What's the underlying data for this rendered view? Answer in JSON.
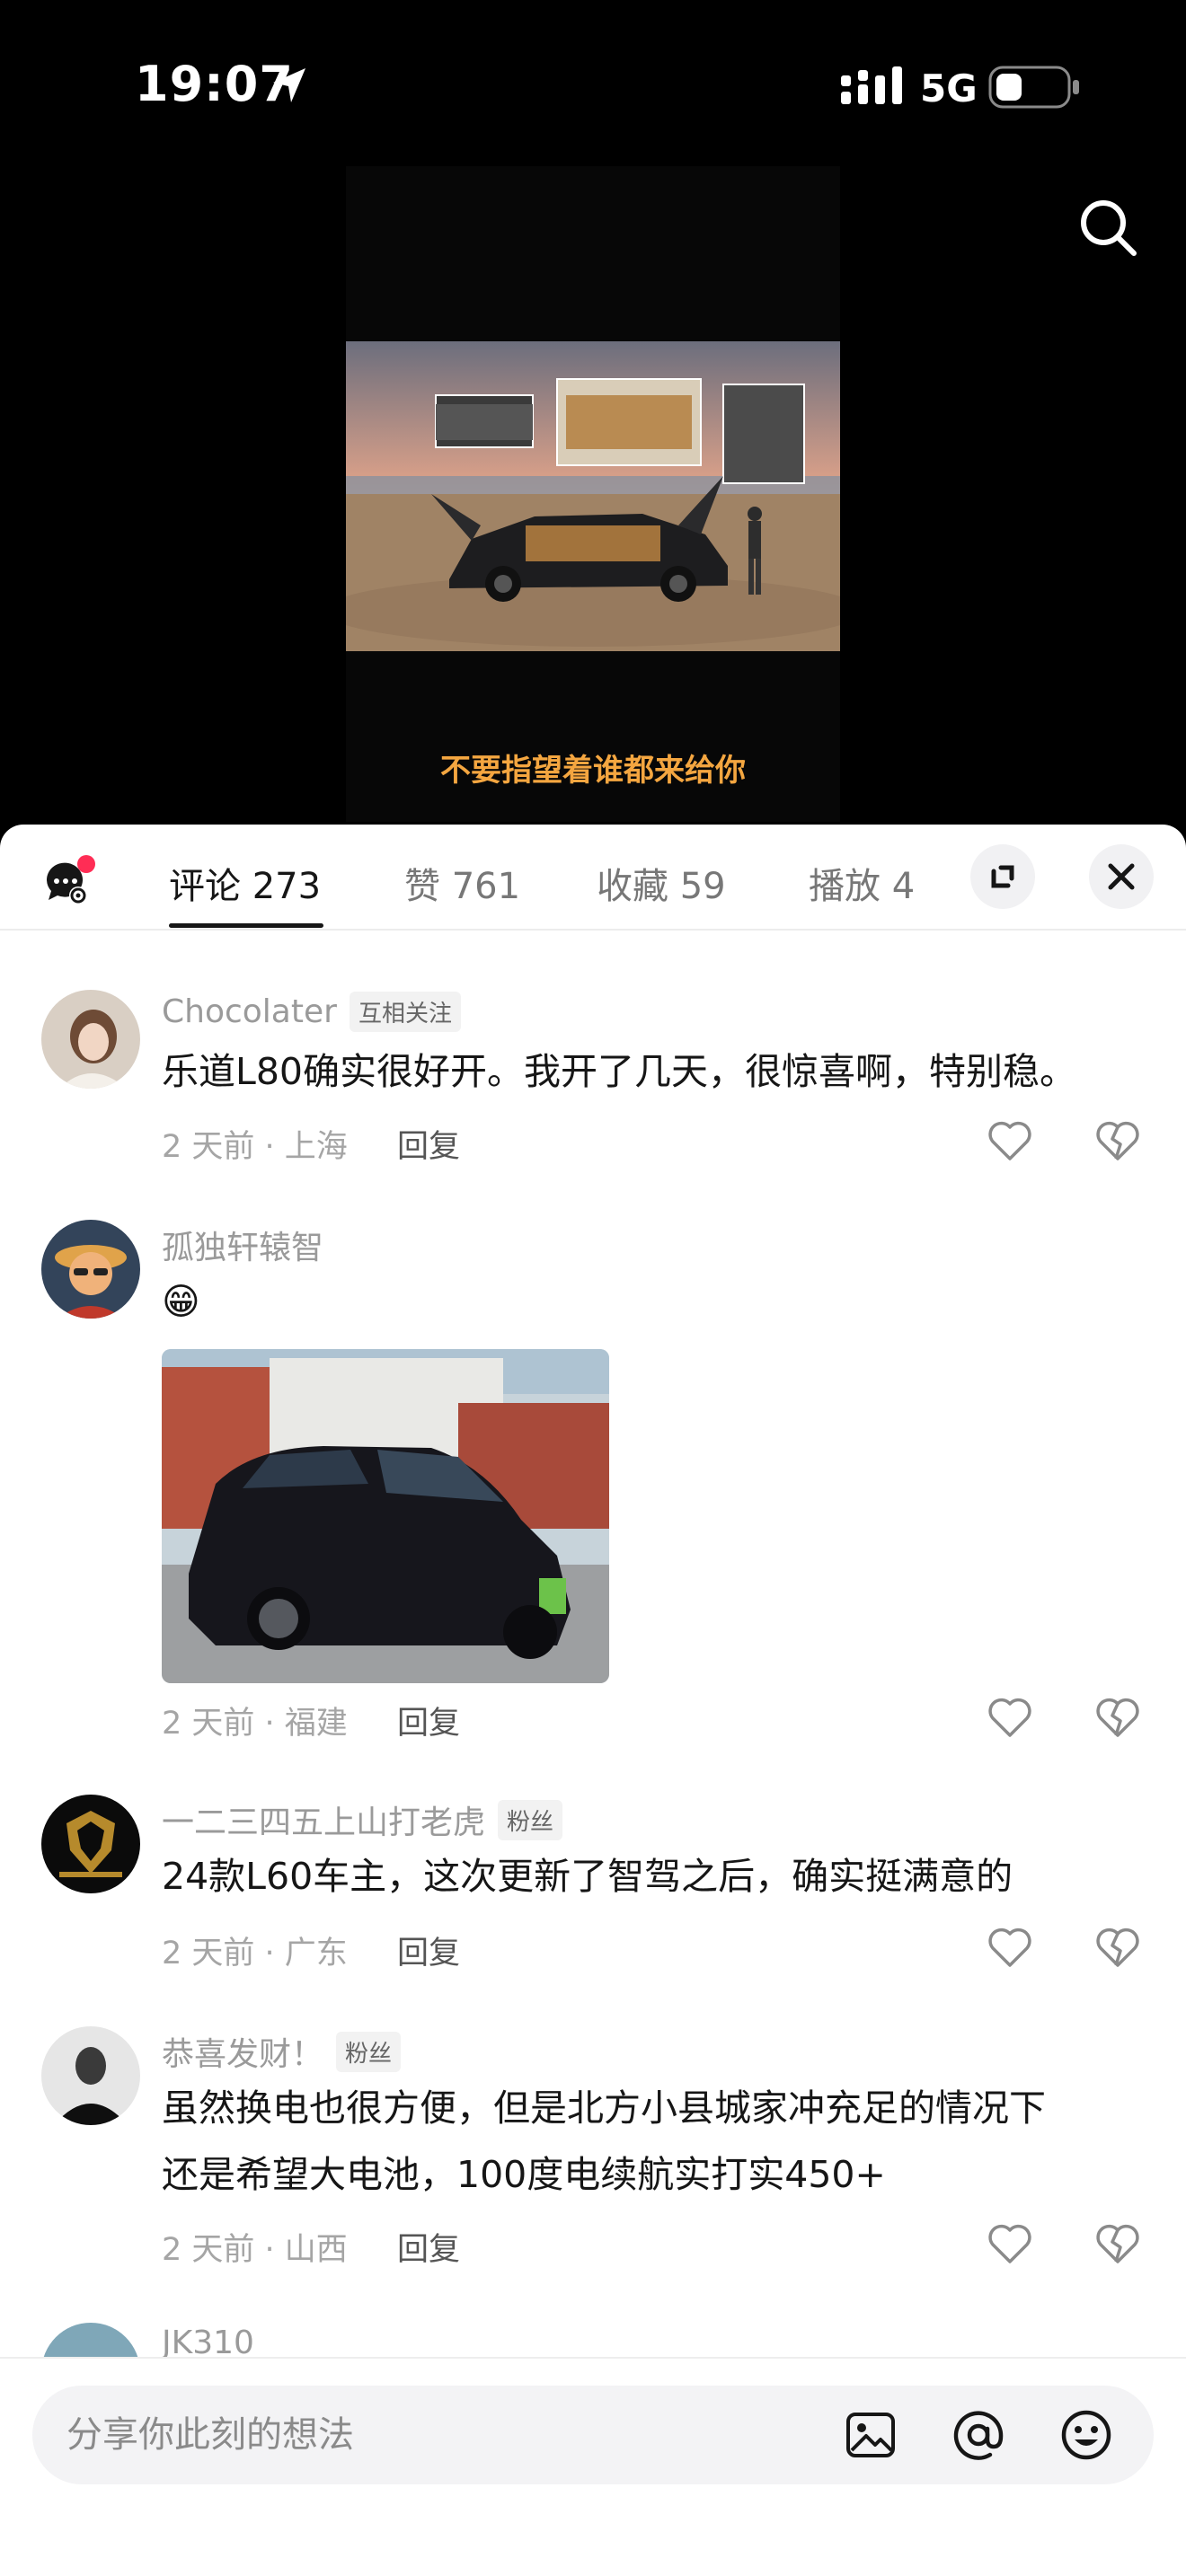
{
  "status_bar": {
    "time": "19:07",
    "network": "5G"
  },
  "video": {
    "caption": "不要指望着谁都来给你"
  },
  "tabs": [
    {
      "label": "评论 273"
    },
    {
      "label": "赞 761"
    },
    {
      "label": "收藏 59"
    },
    {
      "label": "播放 4"
    }
  ],
  "comments": [
    {
      "username": "Chocolater",
      "badge": "互相关注",
      "text": "乐道L80确实很好开。我开了几天，很惊喜啊，特别稳。",
      "time_location": "2 天前 · 上海",
      "reply": "回复"
    },
    {
      "username": "孤独轩辕智",
      "text": "😁",
      "time_location": "2 天前 · 福建",
      "reply": "回复"
    },
    {
      "username": "一二三四五上山打老虎",
      "badge": "粉丝",
      "text": "24款L60车主，这次更新了智驾之后，确实挺满意的",
      "time_location": "2 天前 · 广东",
      "reply": "回复"
    },
    {
      "username": "恭喜发财！",
      "badge": "粉丝",
      "text_line1": "虽然换电也很方便，但是北方小县城家冲充足的情况下",
      "text_line2": "还是希望大电池，100度电续航实打实450+",
      "time_location": "2 天前 · 山西",
      "reply": "回复"
    },
    {
      "username": "JK310"
    }
  ],
  "input": {
    "placeholder": "分享你此刻的想法"
  },
  "colors": {
    "caption": "#f4a640",
    "notification_dot": "#ff2d55",
    "sheet_bg": "#ffffff"
  }
}
